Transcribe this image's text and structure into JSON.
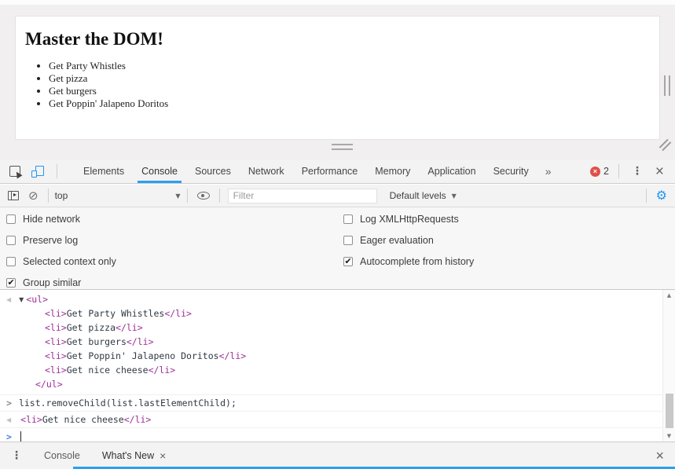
{
  "preview": {
    "heading": "Master the DOM!",
    "list_items": [
      "Get Party Whistles",
      "Get pizza",
      "Get burgers",
      "Get Poppin' Jalapeno Doritos"
    ]
  },
  "devtools": {
    "tabs": [
      "Elements",
      "Console",
      "Sources",
      "Network",
      "Performance",
      "Memory",
      "Application",
      "Security"
    ],
    "selected_tab": "Console",
    "error_count": "2"
  },
  "console_toolbar": {
    "context": "top",
    "filter_placeholder": "Filter",
    "levels_label": "Default levels"
  },
  "settings": {
    "items": [
      {
        "label": "Hide network",
        "checked": false
      },
      {
        "label": "Preserve log",
        "checked": false
      },
      {
        "label": "Selected context only",
        "checked": false
      },
      {
        "label": "Group similar",
        "checked": true
      },
      {
        "label": "Log XMLHttpRequests",
        "checked": false
      },
      {
        "label": "Eager evaluation",
        "checked": false
      },
      {
        "label": "Autocomplete from history",
        "checked": true
      }
    ]
  },
  "console": {
    "syntax": {
      "ul_open": "<ul>",
      "ul_close": "</ul>",
      "li_open": "<li>",
      "li_close": "</li>"
    },
    "tree_items": [
      "Get Party Whistles",
      "Get pizza",
      "Get burgers",
      "Get Poppin' Jalapeno Doritos",
      "Get nice cheese"
    ],
    "command": "list.removeChild(list.lastElementChild);",
    "result_text": "Get nice cheese"
  },
  "drawer": {
    "tab_console": "Console",
    "tab_whats_new": "What's New"
  },
  "icons": {
    "overflow_chevron": "»",
    "dropdown_caret": "▼",
    "clear_console": "⊘",
    "settings_gear": "⚙",
    "menu_dots": "⋮",
    "close": "×",
    "error_cross": "×",
    "return_arrow": "◀",
    "twisty_expanded": "▼",
    "prompt_chevron": ">",
    "scroll_up": "▲",
    "scroll_down": "▼"
  },
  "colors": {
    "accent_blue": "#2ba0f0",
    "error_red": "#df5049",
    "tag_purple": "#9c2f96"
  }
}
